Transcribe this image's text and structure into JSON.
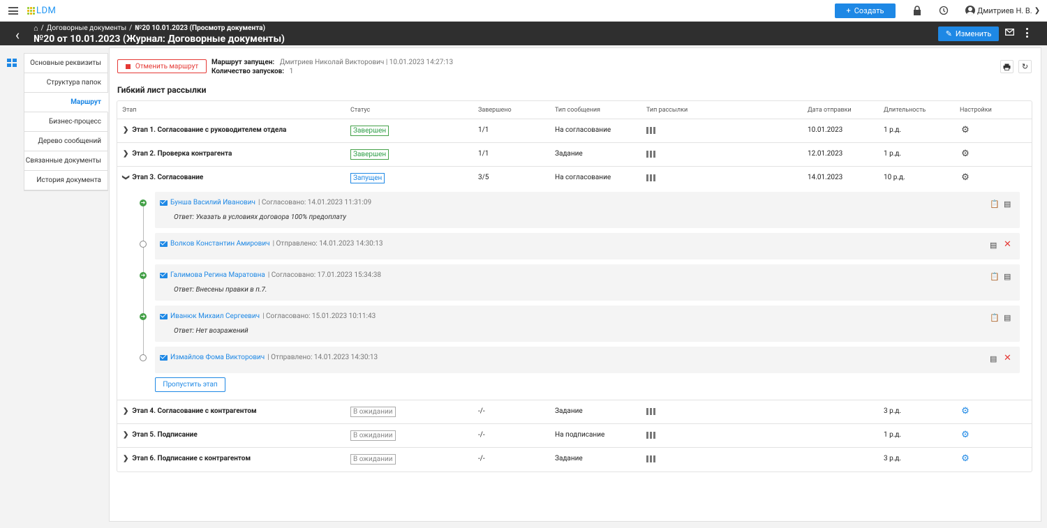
{
  "app": {
    "logo": "LDM",
    "create_label": "Создать",
    "user_name": "Дмитриев Н. В."
  },
  "header": {
    "breadcrumb": [
      "Договорные документы",
      "№20 10.01.2023  (Просмотр документа)"
    ],
    "title": "№20 от 10.01.2023 (Журнал: Договорные документы)",
    "edit_label": "Изменить"
  },
  "tabs": [
    "Основные реквизиты",
    "Структура папок",
    "Маршрут",
    "Бизнес-процесс",
    "Дерево сообщений",
    "Связанные документы",
    "История документа"
  ],
  "active_tab": "Маршрут",
  "route": {
    "cancel_label": "Отменить маршрут",
    "launched_label": "Маршрут запущен:",
    "launched_value": "Дмитриев Николай Викторович  |  10.01.2023 14:27:13",
    "count_label": "Количество запусков:",
    "count_value": "1"
  },
  "section_title": "Гибкий лист рассылки",
  "columns": [
    "Этап",
    "Статус",
    "Завершено",
    "Тип сообщения",
    "Тип рассылки",
    "Дата отправки",
    "Длительность",
    "Настройки"
  ],
  "stages": [
    {
      "name": "Этап 1. Согласование с руководителем отдела",
      "status": "Завершен",
      "done": "1/1",
      "msg_type": "На согласование",
      "date": "10.01.2023",
      "duration": "1 р.д."
    },
    {
      "name": "Этап 2. Проверка контрагента",
      "status": "Завершен",
      "done": "1/1",
      "msg_type": "Задание",
      "date": "12.01.2023",
      "duration": "1 р.д."
    },
    {
      "name": "Этап 3. Согласование",
      "status": "Запущен",
      "done": "3/5",
      "msg_type": "На согласование",
      "date": "14.01.2023",
      "duration": "10 р.д."
    },
    {
      "name": "Этап 4. Согласование с контрагентом",
      "status": "В ожидании",
      "done": "-/-",
      "msg_type": "Задание",
      "date": "",
      "duration": "3 р.д."
    },
    {
      "name": "Этап 5. Подписание",
      "status": "В ожидании",
      "done": "-/-",
      "msg_type": "На подписание",
      "date": "",
      "duration": "1 р.д."
    },
    {
      "name": "Этап 6. Подписание с контрагентом",
      "status": "В ожидании",
      "done": "-/-",
      "msg_type": "Задание",
      "date": "",
      "duration": "3 р.д."
    }
  ],
  "participants": [
    {
      "name": "Бунша Василий Иванович",
      "info": "| Согласовано: 14.01.2023 11:31:09",
      "answer": "Ответ: Указать в условиях договора 100% предоплату"
    },
    {
      "name": "Волков Константин Амирович",
      "info": "| Отправлено: 14.01.2023 14:30:13",
      "answer": ""
    },
    {
      "name": "Галимова Регина Маратовна",
      "info": "| Согласовано: 17.01.2023 15:34:38",
      "answer": "Ответ: Внесены правки в п.7."
    },
    {
      "name": "Иванюк Михаил Сергеевич",
      "info": "| Согласовано: 15.01.2023 10:11:43",
      "answer": "Ответ: Нет возражений"
    },
    {
      "name": "Измайлов Фома Викторович",
      "info": "| Отправлено: 14.01.2023 14:30:13",
      "answer": ""
    }
  ],
  "skip_label": "Пропустить этап"
}
